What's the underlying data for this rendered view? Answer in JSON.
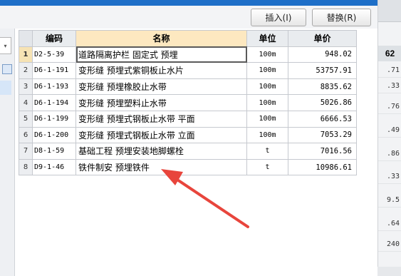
{
  "toolbar": {
    "insert_label": "插入(I)",
    "replace_label": "替换(R)"
  },
  "table": {
    "columns": [
      "编码",
      "名称",
      "单位",
      "单价"
    ],
    "rows": [
      {
        "num": "1",
        "code": "D2-5-39",
        "name": "道路隔离护栏 固定式 预埋",
        "unit": "100m",
        "price": "948.02"
      },
      {
        "num": "2",
        "code": "D6-1-191",
        "name": "变形缝 预埋式紫铜板止水片",
        "unit": "100m",
        "price": "53757.91"
      },
      {
        "num": "3",
        "code": "D6-1-193",
        "name": "变形缝 预埋橡胶止水带",
        "unit": "100m",
        "price": "8835.62"
      },
      {
        "num": "4",
        "code": "D6-1-194",
        "name": "变形缝 预埋塑料止水带",
        "unit": "100m",
        "price": "5026.86"
      },
      {
        "num": "5",
        "code": "D6-1-199",
        "name": "变形缝 预埋式钢板止水带 平面",
        "unit": "100m",
        "price": "6666.53"
      },
      {
        "num": "6",
        "code": "D6-1-200",
        "name": "变形缝 预埋式钢板止水带 立面",
        "unit": "100m",
        "price": "7053.29"
      },
      {
        "num": "7",
        "code": "D8-1-59",
        "name": "基础工程 预埋安装地脚螺栓",
        "unit": "t",
        "price": "7016.56"
      },
      {
        "num": "8",
        "code": "D9-1-46",
        "name": "铁件制安 预埋铁件",
        "unit": "t",
        "price": "10986.61"
      }
    ]
  },
  "right_panel": {
    "header": "62",
    "values": [
      ".71",
      ".33",
      ".76",
      ".49",
      ".86",
      ".33",
      "9.5",
      ".64",
      "240"
    ]
  },
  "annotation": {
    "color": "#e8453c"
  },
  "colors": {
    "title_bar": "#1e6fc8",
    "name_header": "#fde8c0"
  }
}
